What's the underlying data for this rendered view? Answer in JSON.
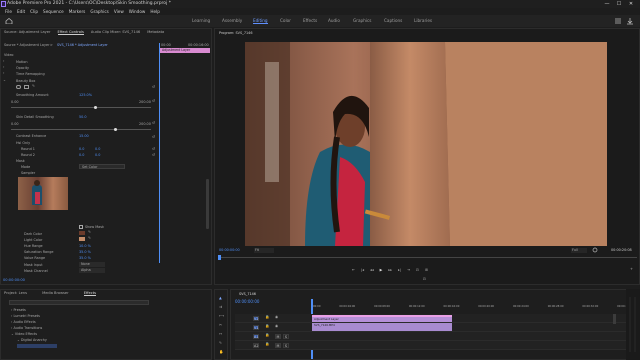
{
  "window": {
    "title": "Adobe Premiere Pro 2021 - C:\\Users\\OC\\Desktop\\Skin Smoothing.prproj *",
    "minimize": "—",
    "maximize": "☐",
    "close": "✕"
  },
  "menu": [
    "File",
    "Edit",
    "Clip",
    "Sequence",
    "Markers",
    "Graphics",
    "View",
    "Window",
    "Help"
  ],
  "workspaces": [
    "Learning",
    "Assembly",
    "Editing",
    "Color",
    "Effects",
    "Audio",
    "Graphics",
    "Captions",
    "Libraries"
  ],
  "workspace_active": "Editing",
  "ws_icon": "workspace-menu-icon",
  "source_tabs": [
    "Source: Adjustment Layer",
    "Effect Controls",
    "Audio Clip Mixer: SVS_7146",
    "Metadata"
  ],
  "ec": {
    "source": "Source * Adjustment Layer",
    "arrow": ">",
    "seq": "SVS_7146 * Adjustment Layer",
    "t0": "00:00",
    "t1": "00:00:16:00",
    "clip_label": "Adjustment Layer",
    "video": "Video",
    "rows": [
      "Motion",
      "Opacity",
      "Time Remapping"
    ],
    "fx": "Beauty Box",
    "smoothing": "Smoothing Amount",
    "smoothing_val": "125.0%",
    "range_lo": "0.00",
    "range_hi": "200.00",
    "detail": "Skin Detail Smoothing",
    "detail_val": "50.0",
    "detail_lo": "0.00",
    "detail_hi": "200.00",
    "contrast": "Contrast Enhance",
    "contrast_val": "15.00",
    "hsl": "Hsl Only",
    "r1": "Round 1",
    "r1a": "0.0",
    "r1b": "0.0",
    "r2": "Round 2",
    "r2a": "0.0",
    "r2b": "0.0",
    "mask": "Mask",
    "mode": "Mode",
    "mode_val": "Set Color",
    "sampler": "Sampler",
    "show_mask": "Show Mask",
    "dark": "Dark Color",
    "light": "Light Color",
    "hue": "Hue Range",
    "hue_val": "10.0 %",
    "sat": "Saturation Range",
    "sat_val": "35.0 %",
    "val": "Value Range",
    "val_val": "35.0 %",
    "mi": "Mask Input",
    "mi_val": "None",
    "mc": "Mask Channel",
    "mc_val": "Alpha",
    "timecode": "00:00:00:00"
  },
  "program": {
    "title": "Program: SVS_7146",
    "timecode": "00:00:00:00",
    "fit": "Fit",
    "full": "Full",
    "duration": "00:00:20:08"
  },
  "transport": [
    "⇤",
    "|◂",
    "◂◂",
    "▶",
    "▸▸",
    "▸|",
    "⇥",
    "⊡",
    "⊞",
    "+"
  ],
  "project": {
    "tabs": [
      "Project: Lens",
      "Media Browser",
      "Effects"
    ],
    "items": [
      "Presets",
      "Lumetri Presets",
      "Audio Effects",
      "Audio Transitions",
      "Video Effects",
      "Digital Anarchy"
    ]
  },
  "timeline": {
    "tab": "SVS_7146",
    "tc": "00:00:00:00",
    "ruler": [
      "00:00",
      "00:00:04:00",
      "00:00:08:00",
      "00:00:12:00",
      "00:00:16:00",
      "00:00:20:00",
      "00:00:24:00",
      "00:00:28:00",
      "00:00:32:00",
      "00:00:36:00",
      "00:00:40:00"
    ],
    "tracks": [
      {
        "name": "V2"
      },
      {
        "name": "V1"
      },
      {
        "name": "A1"
      },
      {
        "name": "A2"
      }
    ],
    "clip_v2": "Adjustment Layer",
    "clip_v1": "SVS_7146.MP4"
  },
  "colors": {
    "accent": "#4f8ff7",
    "adj": "#d98bd1",
    "clip": "#b590d8",
    "clip_top": "#e9a0e6"
  }
}
